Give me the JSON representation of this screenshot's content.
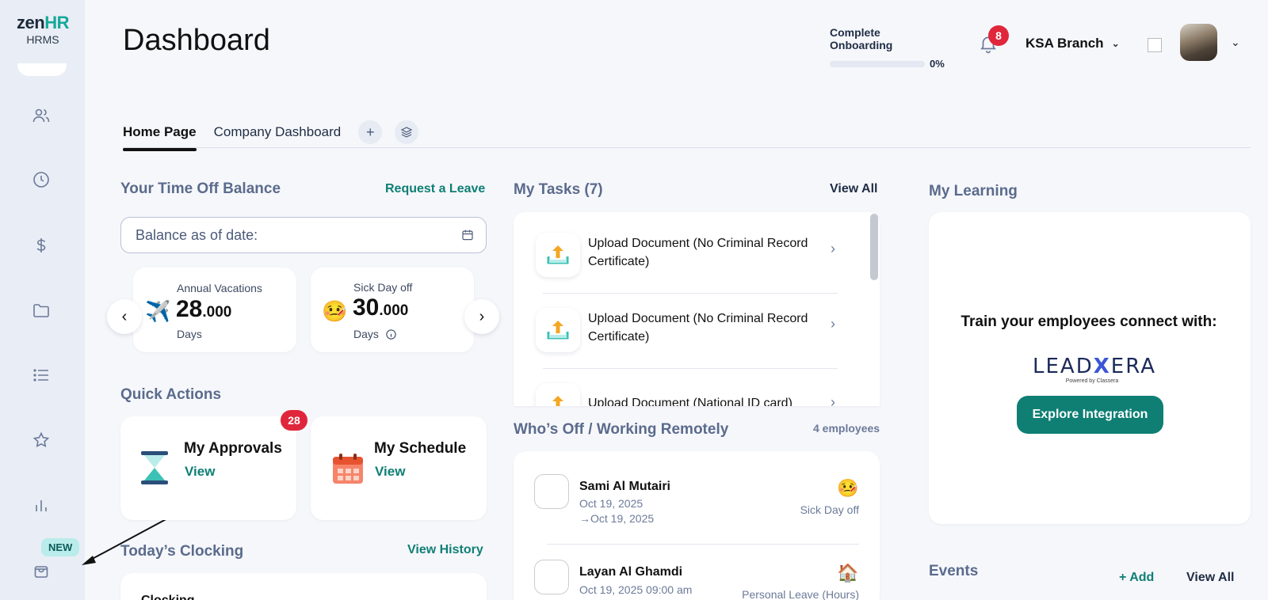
{
  "app": {
    "logo_main": "zen",
    "logo_hr": "HR",
    "logo_sub": "HRMS"
  },
  "sidebar": {
    "items": [
      {
        "icon": "users-icon"
      },
      {
        "icon": "clock-icon"
      },
      {
        "icon": "dollar-icon"
      },
      {
        "icon": "folder-icon"
      },
      {
        "icon": "list-icon"
      },
      {
        "icon": "star-icon"
      },
      {
        "icon": "bar-chart-icon"
      },
      {
        "icon": "shopping-bag-icon"
      }
    ],
    "new_badge": "NEW"
  },
  "header": {
    "title": "Dashboard",
    "onboarding_label": "Complete Onboarding",
    "onboarding_pct": "0%",
    "onboarding_progress": 0,
    "notification_count": "8",
    "branch": "KSA Branch"
  },
  "tabs": [
    {
      "label": "Home Page",
      "active": true
    },
    {
      "label": "Company Dashboard",
      "active": false
    }
  ],
  "time_off": {
    "title": "Your Time Off Balance",
    "request_link": "Request a Leave",
    "balance_placeholder": "Balance as of date:",
    "cards": [
      {
        "label": "Annual Vacations",
        "value_int": "28",
        "value_dec": ".000",
        "unit": "Days",
        "icon": "✈️"
      },
      {
        "label": "Sick Day off",
        "value_int": "30",
        "value_dec": ".000",
        "unit": "Days",
        "icon": "🤒"
      }
    ]
  },
  "quick_actions": {
    "title": "Quick Actions",
    "items": [
      {
        "title": "My Approvals",
        "link": "View",
        "badge": "28"
      },
      {
        "title": "My Schedule",
        "link": "View"
      }
    ]
  },
  "clocking": {
    "title": "Today’s Clocking",
    "link": "View History",
    "card_label": "Clocking"
  },
  "tasks": {
    "title": "My Tasks (7)",
    "link": "View All",
    "items": [
      {
        "text": "Upload Document (No Criminal Record Certificate)"
      },
      {
        "text": "Upload Document (No Criminal Record Certificate)"
      },
      {
        "text": "Upload Document (National ID card)"
      }
    ]
  },
  "whos_off": {
    "title": "Who’s Off / Working Remotely",
    "count": "4 employees",
    "people": [
      {
        "name": "Sami Al Mutairi",
        "date_from": "Oct 19, 2025",
        "date_to": "Oct 19, 2025",
        "type": "Sick Day off",
        "emoji": "🤒"
      },
      {
        "name": "Layan Al Ghamdi",
        "date_from": "Oct 19, 2025 09:00 am",
        "type": "Personal Leave (Hours)",
        "emoji": "🏠"
      }
    ]
  },
  "learning": {
    "title": "My Learning",
    "text": "Train your employees connect with:",
    "brand_a": "LEAD",
    "brand_x": "X",
    "brand_b": "ERA",
    "brand_sub": "Powered by Classera",
    "button": "Explore Integration"
  },
  "events": {
    "title": "Events",
    "add": "+ Add",
    "view_all": "View All"
  }
}
